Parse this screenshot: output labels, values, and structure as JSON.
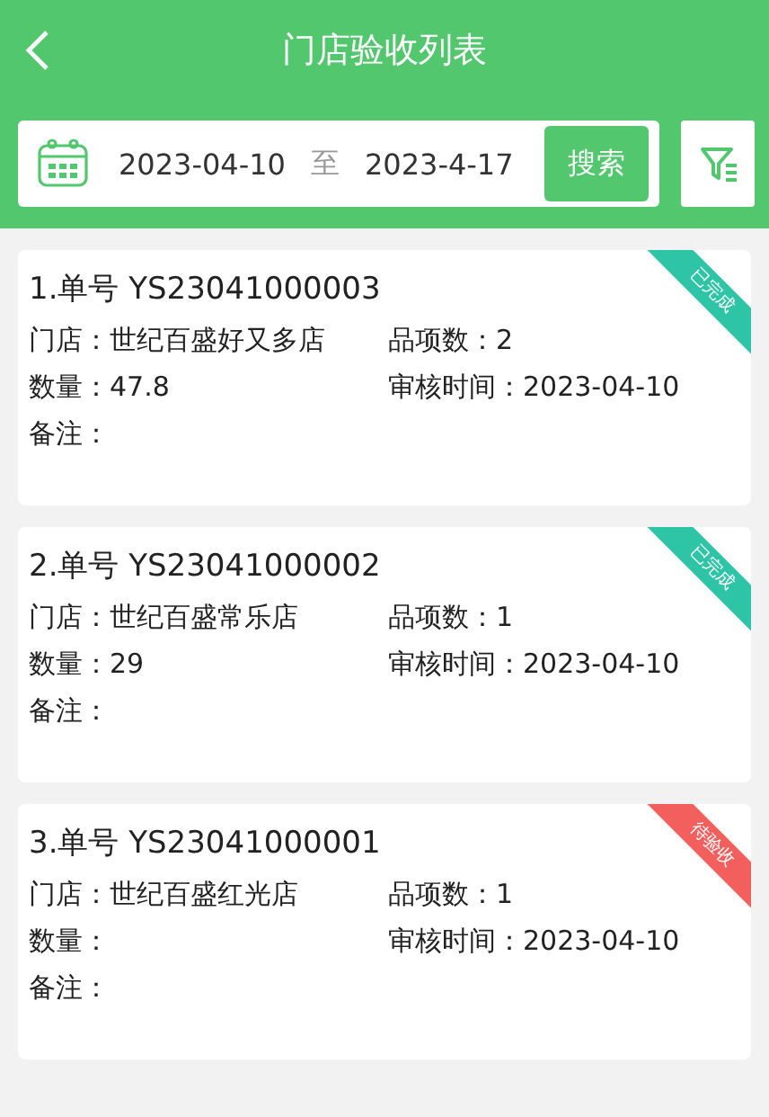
{
  "header": {
    "title": "门店验收列表"
  },
  "search": {
    "start_date": "2023-04-10",
    "separator": "至",
    "end_date": "2023-4-17",
    "button": "搜索"
  },
  "orders": [
    {
      "title": "1.单号 YS23041000003",
      "status": "已完成",
      "color": "#2ec4a6",
      "store_label": "门店：",
      "store": "世纪百盛好又多店",
      "items_label": "品项数：",
      "items": "2",
      "qty_label": "数量：",
      "qty": "47.8",
      "time_label": "审核时间：",
      "time": "2023-04-10",
      "note_label": "备注："
    },
    {
      "title": "2.单号 YS23041000002",
      "status": "已完成",
      "color": "#2ec4a6",
      "store_label": "门店：",
      "store": "世纪百盛常乐店",
      "items_label": "品项数：",
      "items": "1",
      "qty_label": "数量：",
      "qty": "29",
      "time_label": "审核时间：",
      "time": "2023-04-10",
      "note_label": "备注："
    },
    {
      "title": "3.单号 YS23041000001",
      "status": "待验收",
      "color": "#f25f5c",
      "store_label": "门店：",
      "store": "世纪百盛红光店",
      "items_label": "品项数：",
      "items": "1",
      "qty_label": "数量：",
      "time_label": "审核时间：",
      "time": "2023-04-10",
      "note_label": "备注："
    }
  ]
}
